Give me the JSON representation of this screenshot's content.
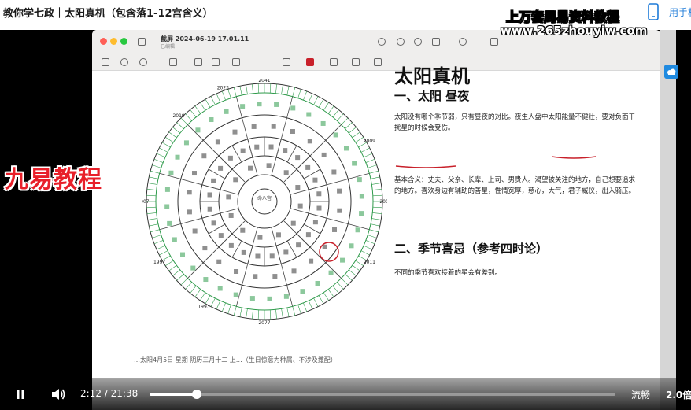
{
  "page": {
    "title": "教你学七政｜太阳真机（包含落1-12宫含义）",
    "phone_label": "用手机"
  },
  "window": {
    "title": "截屏 2024-06-19 17.01.11",
    "subtitle": "已编辑"
  },
  "watermark": {
    "line1": "上万套周易资料教程",
    "line2": "www.265zhouyiw.com"
  },
  "logo": {
    "text": "九易教程"
  },
  "document": {
    "title": "太阳真机",
    "section1": "一、太阳 昼夜",
    "para1": "太阳没有哪个季节弱，只有昼夜的对比。夜生人盘中太阳能量不健壮，要对负面干扰星的时候会受伤。",
    "para2": "基本含义：丈夫、父亲、长辈、上司、男贵人。渴望被关注的地方，自己想要追求的地方。喜欢身边有辅助的善星，性情宽厚，慈心，大气，君子威仪，出入骑压。",
    "section2": "二、季节喜忌（参考四时论）",
    "para3": "不同的季节喜欢接着的星会有差别。",
    "bottom": "…太阳4月5日 星期 阴历三月十二 上…（生日惊意为种属、不涉及撒配）"
  },
  "wheel": {
    "center_text": "命八宫",
    "year_labels": [
      "2041",
      "2003",
      "2007",
      "2077",
      "2019",
      "2023",
      "2009",
      "2011",
      "1997",
      "1993"
    ]
  },
  "player": {
    "current_time": "2:12",
    "separator": "/",
    "total_time": "21:38",
    "progress": 0.102,
    "quality": "流畅",
    "speed": "2.0倍"
  },
  "colors": {
    "accent": "#1e7bd8",
    "logo_red": "#e8202a",
    "wheel_green": "#2e9a4a",
    "highlight_red": "#c8202a"
  }
}
